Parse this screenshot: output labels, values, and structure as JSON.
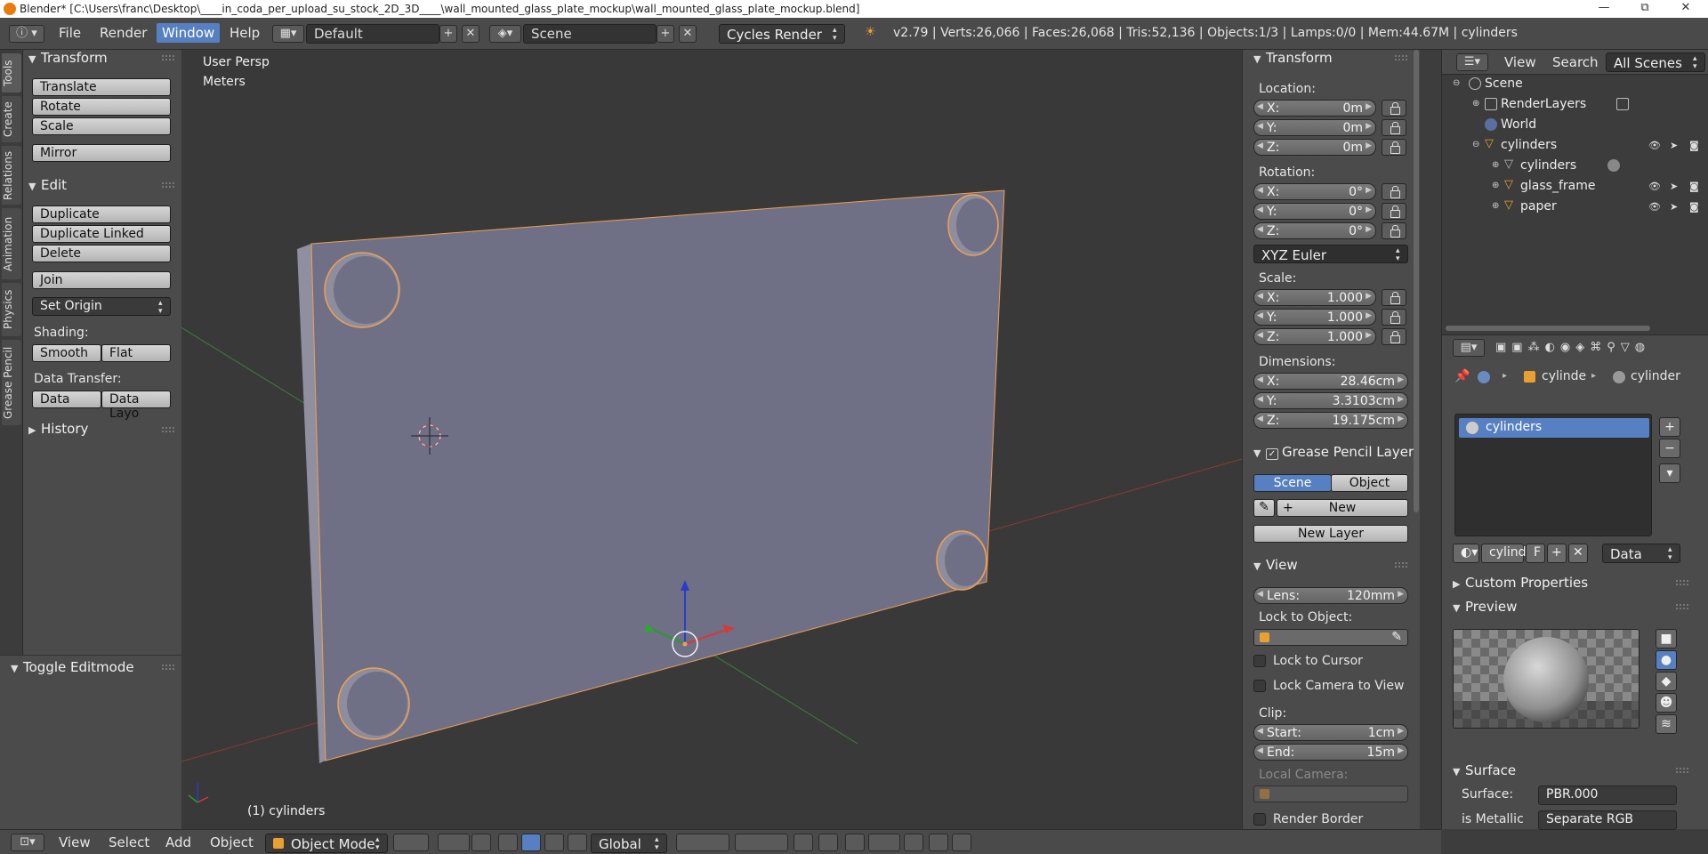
{
  "window": {
    "title": "Blender* [C:\\Users\\franc\\Desktop\\____in_coda_per_upload_su_stock_2D_3D____\\wall_mounted_glass_plate_mockup\\wall_mounted_glass_plate_mockup.blend]",
    "minimize": "—",
    "maximize": "⧉",
    "close": "✕"
  },
  "header": {
    "menus": [
      "File",
      "Render",
      "Window",
      "Help"
    ],
    "active_menu": "Window",
    "layout": "Default",
    "scene": "Scene",
    "render_engine": "Cycles Render",
    "info": "v2.79 | Verts:26,066 | Faces:26,068 | Tris:52,136 | Objects:1/3 | Lamps:0/0 | Mem:44.67M | cylinders"
  },
  "tool_tabs": [
    "Tools",
    "Create",
    "Relations",
    "Animation",
    "Physics",
    "Grease Pencil"
  ],
  "toolshelf": {
    "transform_title": "Transform",
    "transform_buttons": [
      "Translate",
      "Rotate",
      "Scale",
      "Mirror"
    ],
    "edit_title": "Edit",
    "edit_buttons": [
      "Duplicate",
      "Duplicate Linked",
      "Delete",
      "Join"
    ],
    "set_origin": "Set Origin",
    "shading_label": "Shading:",
    "smooth": "Smooth",
    "flat": "Flat",
    "data_transfer_label": "Data Transfer:",
    "data": "Data",
    "data_layout": "Data Layo",
    "history": "History",
    "toggle_editmode": "Toggle Editmode"
  },
  "viewport": {
    "view_name": "User Persp",
    "units": "Meters",
    "object_label": "(1) cylinders"
  },
  "npanel": {
    "transform_title": "Transform",
    "location_label": "Location:",
    "location": [
      [
        "X:",
        "0m"
      ],
      [
        "Y:",
        "0m"
      ],
      [
        "Z:",
        "0m"
      ]
    ],
    "rotation_label": "Rotation:",
    "rotation": [
      [
        "X:",
        "0°"
      ],
      [
        "Y:",
        "0°"
      ],
      [
        "Z:",
        "0°"
      ]
    ],
    "rotation_mode": "XYZ Euler",
    "scale_label": "Scale:",
    "scale": [
      [
        "X:",
        "1.000"
      ],
      [
        "Y:",
        "1.000"
      ],
      [
        "Z:",
        "1.000"
      ]
    ],
    "dimensions_label": "Dimensions:",
    "dimensions": [
      [
        "X:",
        "28.46cm"
      ],
      [
        "Y:",
        "3.3103cm"
      ],
      [
        "Z:",
        "19.175cm"
      ]
    ],
    "grease_title": "Grease Pencil Layer",
    "scene_btn": "Scene",
    "object_btn": "Object",
    "new_btn": "New",
    "new_layer_btn": "New Layer",
    "view_title": "View",
    "lens_label": "Lens:",
    "lens_value": "120mm",
    "lock_object_label": "Lock to Object:",
    "lock_cursor": "Lock to Cursor",
    "lock_camera": "Lock Camera to View",
    "clip_label": "Clip:",
    "clip_start_label": "Start:",
    "clip_start": "1cm",
    "clip_end_label": "End:",
    "clip_end": "15m",
    "local_camera_label": "Local Camera:",
    "render_border": "Render Border"
  },
  "outliner": {
    "menus": [
      "View",
      "Search"
    ],
    "filter": "All Scenes",
    "rows": [
      {
        "label": "Scene",
        "indent": 0
      },
      {
        "label": "RenderLayers",
        "indent": 1
      },
      {
        "label": "World",
        "indent": 1
      },
      {
        "label": "cylinders",
        "indent": 1
      },
      {
        "label": "cylinders",
        "indent": 2
      },
      {
        "label": "glass_frame",
        "indent": 2
      },
      {
        "label": "paper",
        "indent": 2
      }
    ]
  },
  "properties": {
    "breadcrumb_object": "cylinde",
    "breadcrumb_material": "cylinder",
    "slot_item": "cylinders",
    "material_field": "cylind",
    "fake_user": "F",
    "link_mode": "Data",
    "custom_props": "Custom Properties",
    "preview": "Preview",
    "surface_title": "Surface",
    "surface_label": "Surface:",
    "surface_value": "PBR.000",
    "is_metallic_label": "is Metallic",
    "is_metallic_value": "Separate RGB"
  },
  "bottombar": {
    "menus": [
      "View",
      "Select",
      "Add",
      "Object"
    ],
    "mode": "Object Mode",
    "orientation": "Global"
  },
  "colors": {
    "accent": "#5680c2",
    "object_face": "#6f6f86",
    "selection_outline": "#f0a050",
    "x_axis": "#b33b3b",
    "y_axis": "#3b9b3b"
  }
}
